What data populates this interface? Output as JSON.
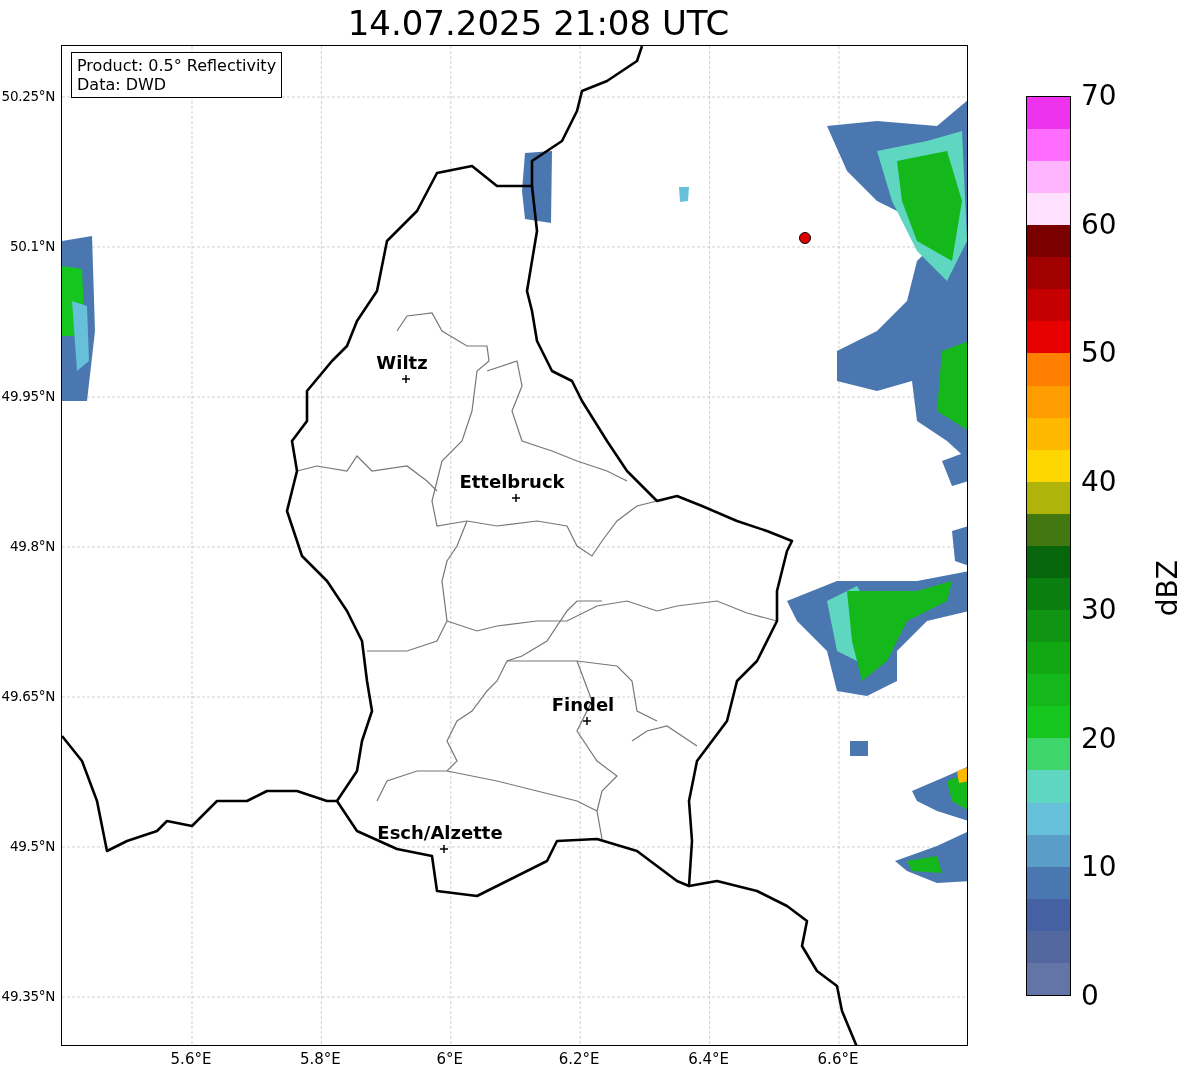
{
  "title": "14.07.2025 21:08 UTC",
  "info_box": {
    "lines": [
      "Product: 0.5° Reflectivity",
      "Data: DWD"
    ]
  },
  "lat_labels": [
    "50.25°N",
    "50.1°N",
    "49.95°N",
    "49.8°N",
    "49.65°N",
    "49.5°N",
    "49.35°N"
  ],
  "lon_labels": [
    "5.6°E",
    "5.8°E",
    "6°E",
    "6.2°E",
    "6.4°E",
    "6.6°E"
  ],
  "cities": [
    {
      "name": "Wiltz"
    },
    {
      "name": "Ettelbruck"
    },
    {
      "name": "Findel"
    },
    {
      "name": "Esch/Alzette"
    }
  ],
  "colorbar": {
    "label": "dBZ",
    "ticks": [
      "70",
      "60",
      "50",
      "40",
      "30",
      "20",
      "10",
      "0"
    ],
    "bins": [
      {
        "color": "#6374a6"
      },
      {
        "color": "#5468a0"
      },
      {
        "color": "#4561a3"
      },
      {
        "color": "#4a77b0"
      },
      {
        "color": "#5a9dc8"
      },
      {
        "color": "#66c0da"
      },
      {
        "color": "#5fd6c0"
      },
      {
        "color": "#3ed56a"
      },
      {
        "color": "#14c61e"
      },
      {
        "color": "#14b81a"
      },
      {
        "color": "#12a814"
      },
      {
        "color": "#0f9512"
      },
      {
        "color": "#0b7e10"
      },
      {
        "color": "#07650c"
      },
      {
        "color": "#437810"
      },
      {
        "color": "#b0b40a"
      },
      {
        "color": "#ffd700"
      },
      {
        "color": "#ffb800"
      },
      {
        "color": "#ff9c00"
      },
      {
        "color": "#ff7f00"
      },
      {
        "color": "#e60000"
      },
      {
        "color": "#c40000"
      },
      {
        "color": "#a00000"
      },
      {
        "color": "#7a0000"
      },
      {
        "color": "#ffe0ff"
      },
      {
        "color": "#ffb4ff"
      },
      {
        "color": "#ff6cff"
      },
      {
        "color": "#ee33ee"
      }
    ]
  }
}
